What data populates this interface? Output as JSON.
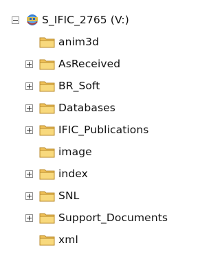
{
  "tree": {
    "root": {
      "label": "S_IFIC_2765 (V:)",
      "expanded": true,
      "icon": "network-drive-icon"
    },
    "children": [
      {
        "label": "anim3d",
        "has_children": false,
        "icon": "folder-icon"
      },
      {
        "label": "AsReceived",
        "has_children": true,
        "icon": "folder-icon"
      },
      {
        "label": "BR_Soft",
        "has_children": true,
        "icon": "folder-icon"
      },
      {
        "label": "Databases",
        "has_children": true,
        "icon": "folder-icon"
      },
      {
        "label": "IFIC_Publications",
        "has_children": true,
        "icon": "folder-icon"
      },
      {
        "label": "image",
        "has_children": false,
        "icon": "folder-icon"
      },
      {
        "label": "index",
        "has_children": true,
        "icon": "folder-icon"
      },
      {
        "label": "SNL",
        "has_children": true,
        "icon": "folder-icon"
      },
      {
        "label": "Support_Documents",
        "has_children": true,
        "icon": "folder-icon"
      },
      {
        "label": "xml",
        "has_children": false,
        "icon": "folder-icon"
      }
    ]
  }
}
